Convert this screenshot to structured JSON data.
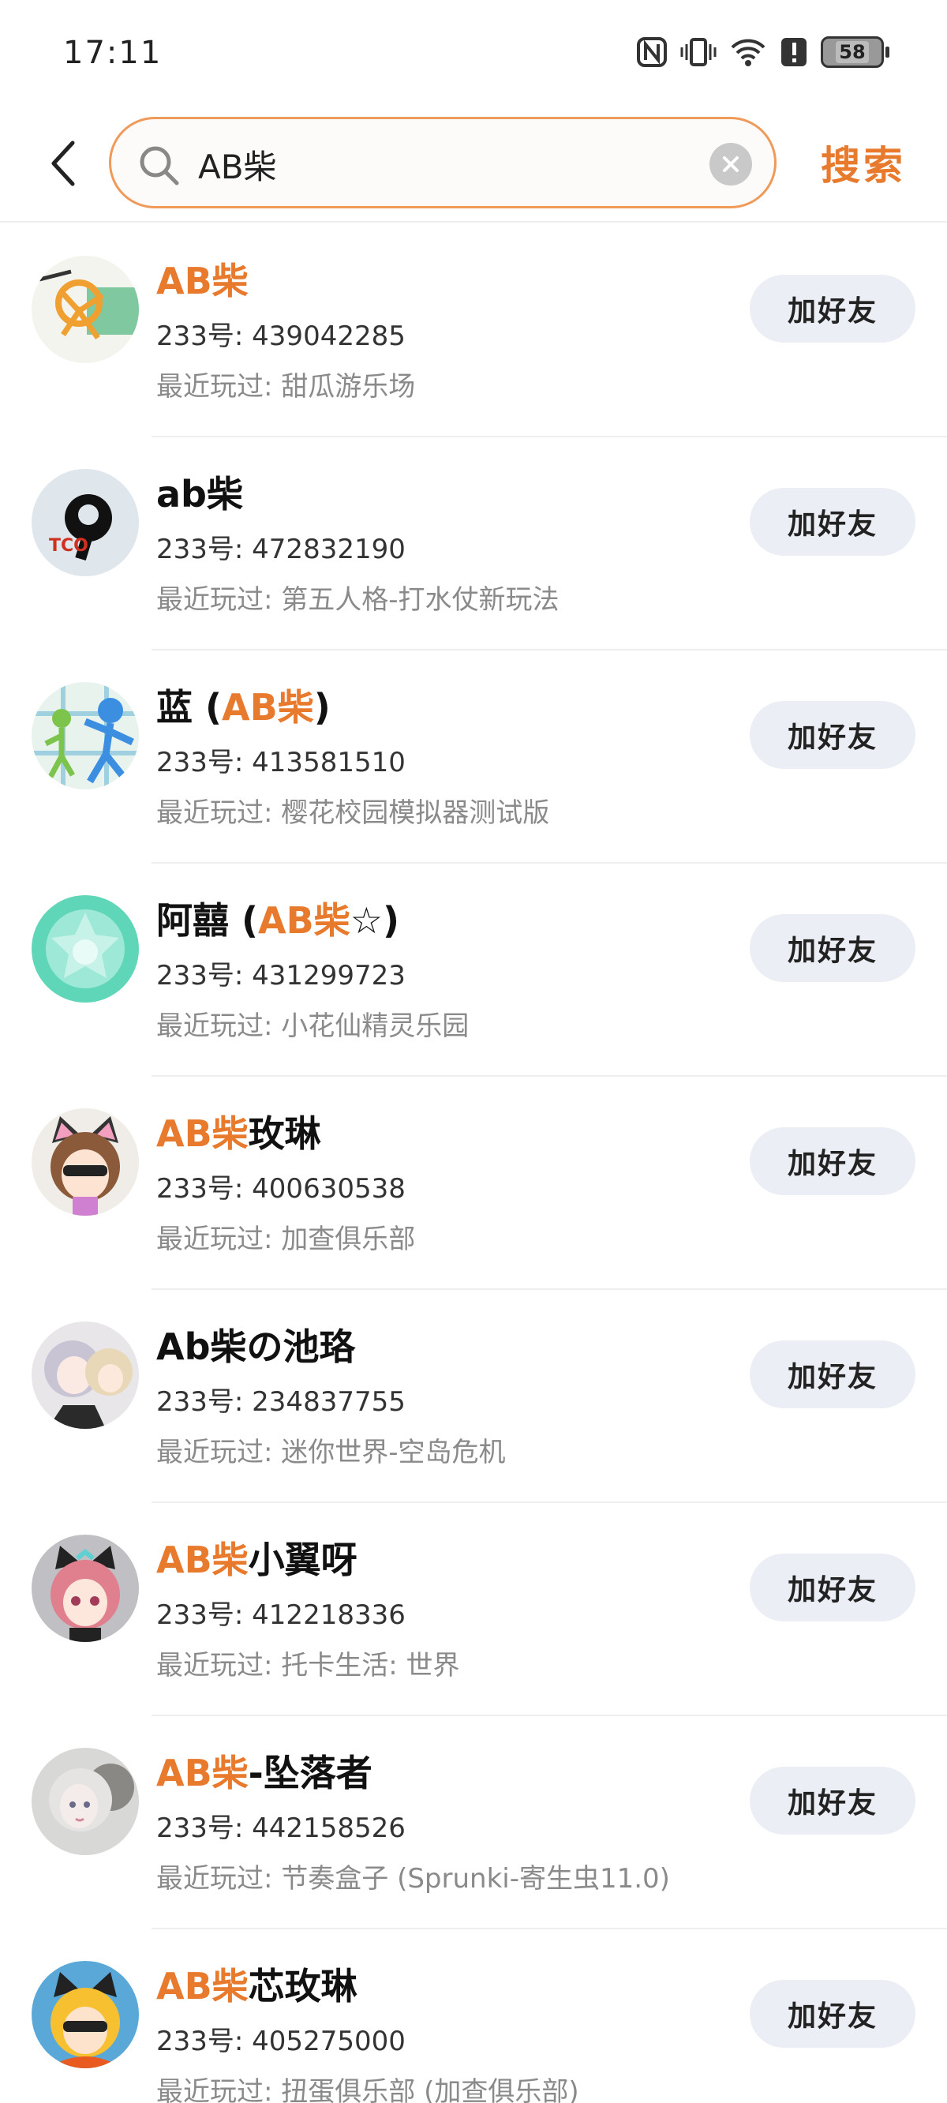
{
  "status_bar": {
    "time": "17:11",
    "battery": "58",
    "icons": [
      "nfc-icon",
      "vibrate-icon",
      "wifi-icon",
      "alert-icon",
      "battery-icon"
    ]
  },
  "search": {
    "query": "AB柴",
    "search_button": "搜索",
    "accent": "#e87a2e"
  },
  "add_label": "加好友",
  "uid_prefix": "233号: ",
  "played_prefix": "最近玩过: ",
  "results": [
    {
      "pre": "",
      "hl": "AB柴",
      "post": "",
      "uid": "439042285",
      "played": "甜瓜游乐场",
      "avatar": "stickman-map"
    },
    {
      "pre": "ab柴",
      "hl": "",
      "post": "",
      "uid": "472832190",
      "played": "第五人格-打水仗新玩法",
      "avatar": "tco-logo"
    },
    {
      "pre": "蓝 (",
      "hl": "AB柴",
      "post": ")",
      "uid": "413581510",
      "played": "樱花校园模拟器测试版",
      "avatar": "stickman-blue"
    },
    {
      "pre": "阿囍 (",
      "hl": "AB柴",
      "post": "☆)",
      "uid": "431299723",
      "played": "小花仙精灵乐园",
      "avatar": "star-mint"
    },
    {
      "pre": "",
      "hl": "AB柴",
      "post": "玫琳",
      "uid": "400630538",
      "played": "加查俱乐部",
      "avatar": "cat-girl-brown"
    },
    {
      "pre": "Ab柴の池珞",
      "hl": "",
      "post": "",
      "uid": "234837755",
      "played": "迷你世界-空岛危机",
      "avatar": "anime-silver"
    },
    {
      "pre": "",
      "hl": "AB柴",
      "post": "小翼呀",
      "uid": "412218336",
      "played": "托卡生活: 世界",
      "avatar": "cat-girl-pink"
    },
    {
      "pre": "",
      "hl": "AB柴",
      "post": "-坠落者",
      "uid": "442158526",
      "played": "节奏盒子 (Sprunki-寄生虫11.0)",
      "avatar": "pale-girl"
    },
    {
      "pre": "",
      "hl": "AB柴",
      "post": "芯玫琳",
      "uid": "405275000",
      "played": "扭蛋俱乐部 (加查俱乐部)",
      "avatar": "cat-girl-blonde"
    }
  ]
}
